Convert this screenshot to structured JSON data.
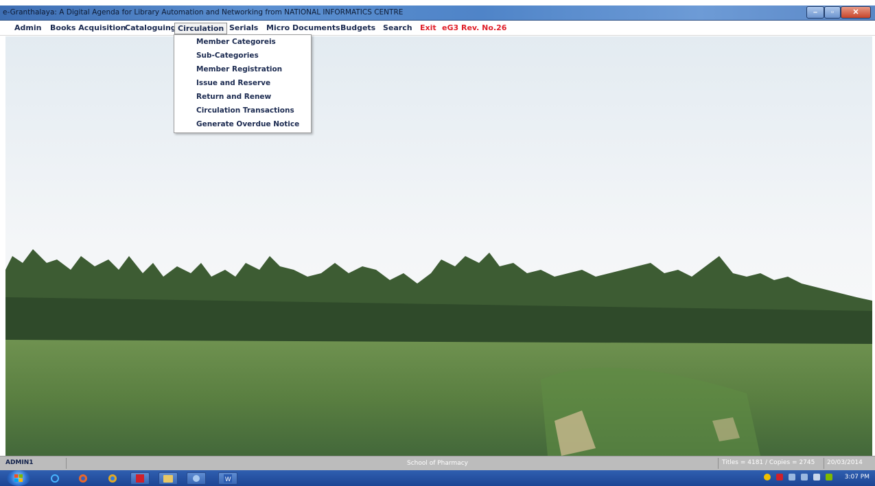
{
  "window": {
    "title": "e-Granthalaya: A Digital Agenda for Library Automation and Networking from NATIONAL INFORMATICS CENTRE"
  },
  "menubar": {
    "items": [
      {
        "label": "Admin"
      },
      {
        "label": "Books Acquisition"
      },
      {
        "label": "Cataloguing"
      },
      {
        "label": "Circulation"
      },
      {
        "label": "Serials"
      },
      {
        "label": "Micro Documents"
      },
      {
        "label": "Budgets"
      },
      {
        "label": "Search"
      },
      {
        "label": "Exit"
      },
      {
        "label": "eG3 Rev. No.26"
      }
    ],
    "active": "Circulation"
  },
  "circulation_menu": {
    "items": [
      {
        "label": "Member Categoreis"
      },
      {
        "label": "Sub-Categories"
      },
      {
        "label": "Member Registration"
      },
      {
        "label": "Issue and Reserve"
      },
      {
        "label": "Return and Renew"
      },
      {
        "label": "Circulation Transactions"
      },
      {
        "label": "Generate Overdue Notice"
      }
    ]
  },
  "statusbar": {
    "user": "ADMIN1",
    "school": "School of Pharmacy",
    "titles": "Titles = 4181 / Copies = 2745",
    "date": "20/03/2014"
  },
  "taskbar": {
    "clock": "3:07 PM"
  },
  "colors": {
    "titlebar": "#4f84c8",
    "menu_text": "#1b2a50",
    "exit_red": "#e0202a",
    "taskbar": "#1d4594",
    "statusbar": "#bcbcbc"
  }
}
